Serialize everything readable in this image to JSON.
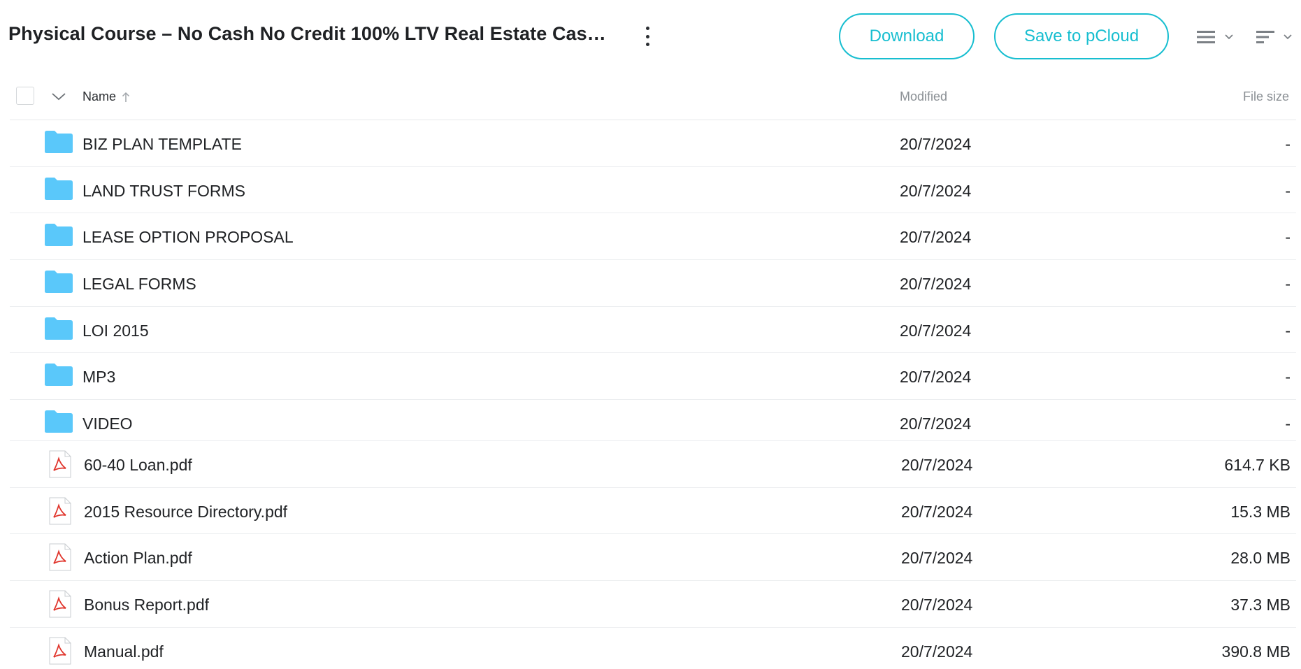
{
  "header": {
    "title": "Physical Course – No Cash No Credit 100% LTV Real Estate Cas…",
    "download_label": "Download",
    "save_label": "Save to pCloud"
  },
  "colors": {
    "accent": "#17bed0",
    "folder": "#5ac8fa",
    "pdf": "#e0342b"
  },
  "table": {
    "columns": {
      "name": "Name",
      "modified": "Modified",
      "size": "File size"
    },
    "sort": {
      "column": "name",
      "direction": "ascending"
    },
    "folders": [
      {
        "name": "BIZ PLAN TEMPLATE",
        "modified": "20/7/2024",
        "size": "-",
        "icon": "folder-icon"
      },
      {
        "name": "LAND TRUST FORMS",
        "modified": "20/7/2024",
        "size": "-",
        "icon": "folder-icon"
      },
      {
        "name": "LEASE OPTION PROPOSAL",
        "modified": "20/7/2024",
        "size": "-",
        "icon": "folder-icon"
      },
      {
        "name": "LEGAL FORMS",
        "modified": "20/7/2024",
        "size": "-",
        "icon": "folder-icon"
      },
      {
        "name": "LOI 2015",
        "modified": "20/7/2024",
        "size": "-",
        "icon": "folder-icon"
      },
      {
        "name": "MP3",
        "modified": "20/7/2024",
        "size": "-",
        "icon": "folder-icon"
      },
      {
        "name": "VIDEO",
        "modified": "20/7/2024",
        "size": "-",
        "icon": "folder-icon"
      }
    ],
    "files": [
      {
        "name": "60-40 Loan.pdf",
        "modified": "20/7/2024",
        "size": "614.7 KB",
        "icon": "pdf-icon"
      },
      {
        "name": "2015 Resource Directory.pdf",
        "modified": "20/7/2024",
        "size": "15.3 MB",
        "icon": "pdf-icon"
      },
      {
        "name": "Action Plan.pdf",
        "modified": "20/7/2024",
        "size": "28.0 MB",
        "icon": "pdf-icon"
      },
      {
        "name": "Bonus Report.pdf",
        "modified": "20/7/2024",
        "size": "37.3 MB",
        "icon": "pdf-icon"
      },
      {
        "name": "Manual.pdf",
        "modified": "20/7/2024",
        "size": "390.8 MB",
        "icon": "pdf-icon"
      }
    ]
  }
}
